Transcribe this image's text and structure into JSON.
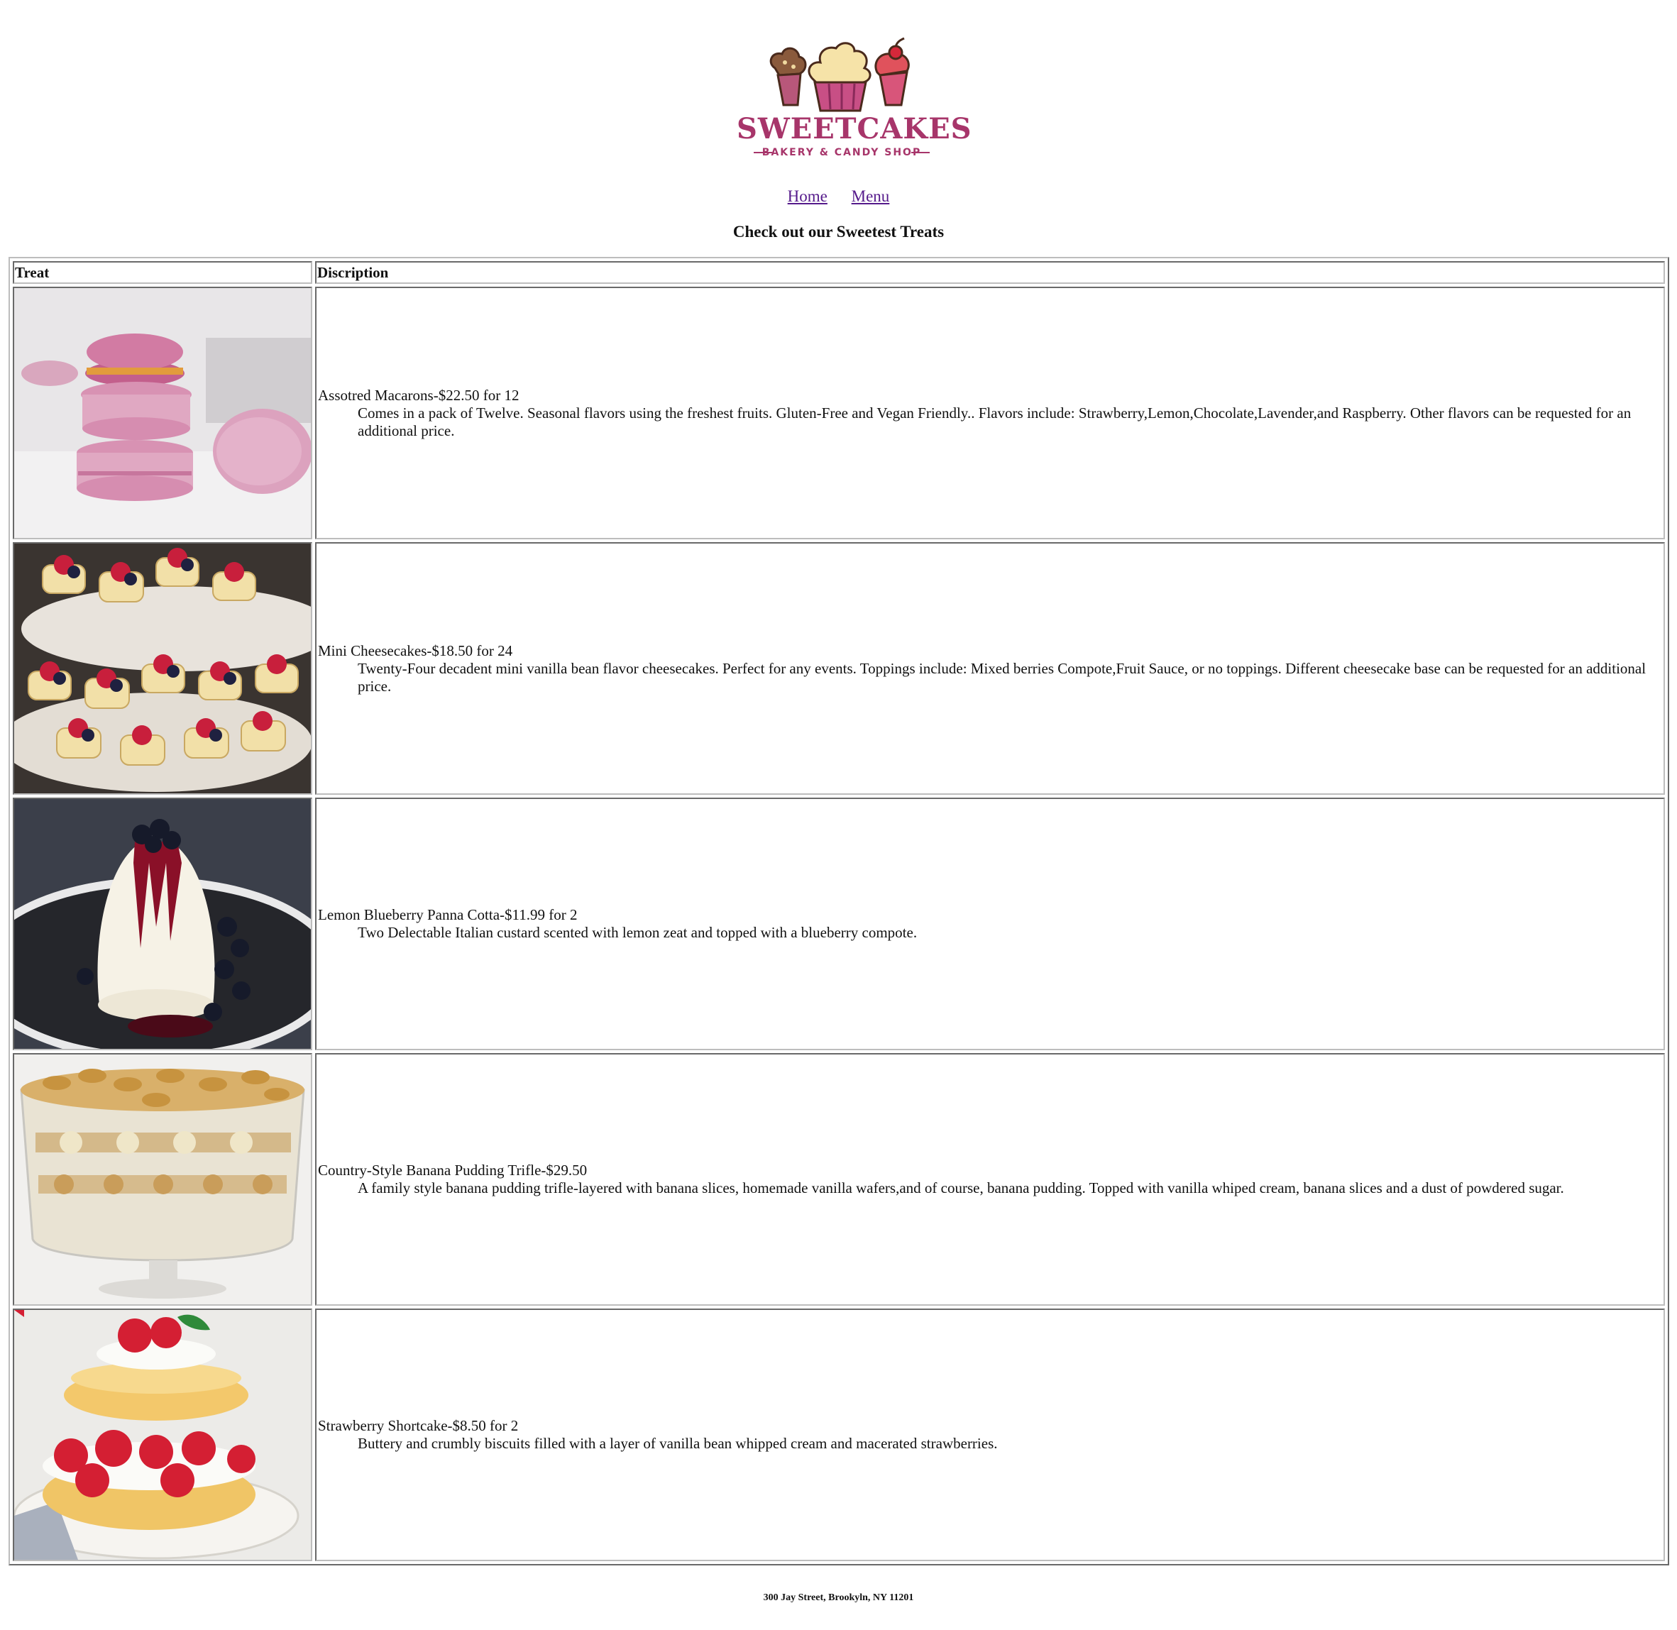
{
  "brand": {
    "name": "SWEETCAKES",
    "tagline": "BAKERY & CANDY SHOP"
  },
  "nav": {
    "items": [
      {
        "label": "Home"
      },
      {
        "label": "Menu"
      }
    ]
  },
  "heading": "Check out our Sweetest Treats",
  "table": {
    "headers": [
      "Treat",
      "Discription"
    ],
    "rows": [
      {
        "image": "macarons-photo",
        "title": "Assotred Macarons-$22.50 for 12",
        "description": "Comes in a pack of Twelve. Seasonal flavors using the freshest fruits. Gluten-Free and Vegan Friendly.. Flavors include: Strawberry,Lemon,Chocolate,Lavender,and Raspberry. Other flavors can be requested for an additional price."
      },
      {
        "image": "cheesecakes-photo",
        "title": "Mini Cheesecakes-$18.50 for 24",
        "description": "Twenty-Four decadent mini vanilla bean flavor cheesecakes. Perfect for any events. Toppings include: Mixed berries Compote,Fruit Sauce, or no toppings. Different cheesecake base can be requested for an additional price."
      },
      {
        "image": "panna-cotta-photo",
        "title": "Lemon Blueberry Panna Cotta-$11.99 for 2",
        "description": "Two Delectable Italian custard scented with lemon zeat and topped with a blueberry compote."
      },
      {
        "image": "banana-trifle-photo",
        "title": "Country-Style Banana Pudding Trifle-$29.50",
        "description": "A family style banana pudding trifle-layered with banana slices, homemade vanilla wafers,and of course, banana pudding. Topped with vanilla whiped cream, banana slices and a dust of powdered sugar."
      },
      {
        "image": "strawberry-shortcake-photo",
        "title": "Strawberry Shortcake-$8.50 for 2",
        "description": "Buttery and crumbly biscuits filled with a layer of vanilla bean whipped cream and macerated strawberries."
      }
    ]
  },
  "footer": "300 Jay Street, Brookyln, NY 11201",
  "colors": {
    "brand": "#a7356a",
    "link": "#551a8b",
    "border": "#bdbdbd"
  }
}
